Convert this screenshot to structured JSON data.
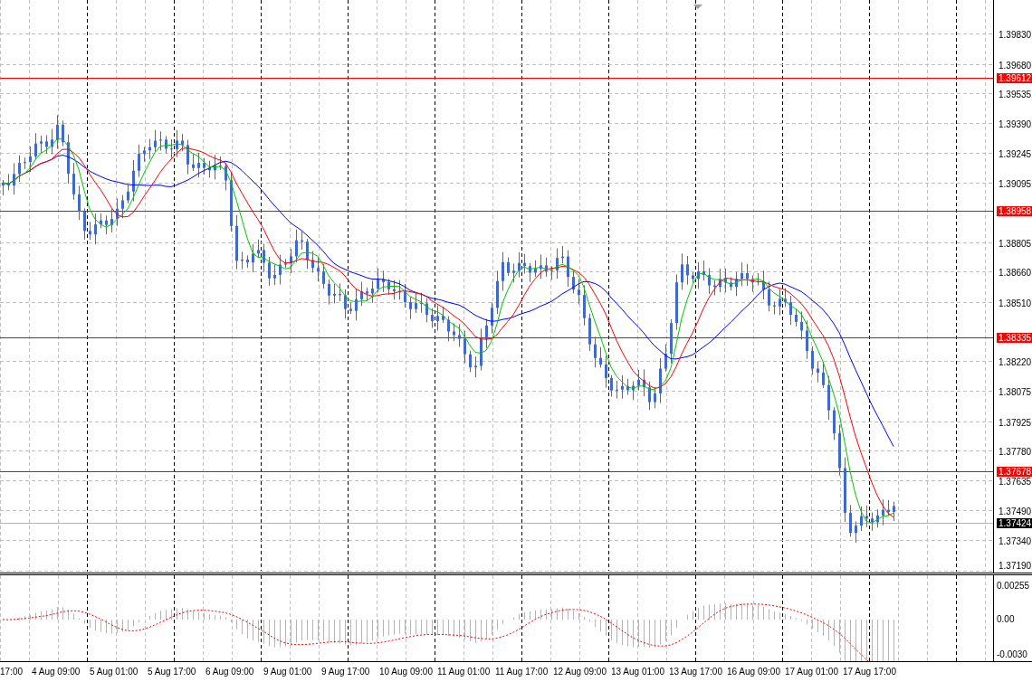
{
  "price_axis": {
    "ticks": [
      "1.39830",
      "1.39680",
      "1.39535",
      "1.39390",
      "1.39245",
      "1.39095",
      "1.38805",
      "1.38660",
      "1.38510",
      "1.38220",
      "1.38075",
      "1.37925",
      "1.37780",
      "1.37635",
      "1.37490",
      "1.37340",
      "1.37190"
    ]
  },
  "price_levels": [
    {
      "label": "1.39612",
      "color": "#ff0000"
    },
    {
      "label": "1.38958",
      "color": "#ff0000"
    },
    {
      "label": "1.38335",
      "color": "#ff0000"
    },
    {
      "label": "1.37678",
      "color": "#ff0000"
    },
    {
      "label": "1.37424",
      "color": "#000000"
    }
  ],
  "indicator_axis": {
    "ticks": [
      "0.00255",
      "0.00",
      "-0.0030"
    ]
  },
  "time_axis": {
    "labels": [
      "17:00",
      "4 Aug 09:00",
      "5 Aug 01:00",
      "5 Aug 17:00",
      "6 Aug 09:00",
      "9 Aug 01:00",
      "9 Aug 17:00",
      "10 Aug 09:00",
      "11 Aug 01:00",
      "11 Aug 17:00",
      "12 Aug 09:00",
      "13 Aug 01:00",
      "13 Aug 17:00",
      "16 Aug 09:00",
      "17 Aug 01:00",
      "17 Aug 17:00"
    ]
  }
}
